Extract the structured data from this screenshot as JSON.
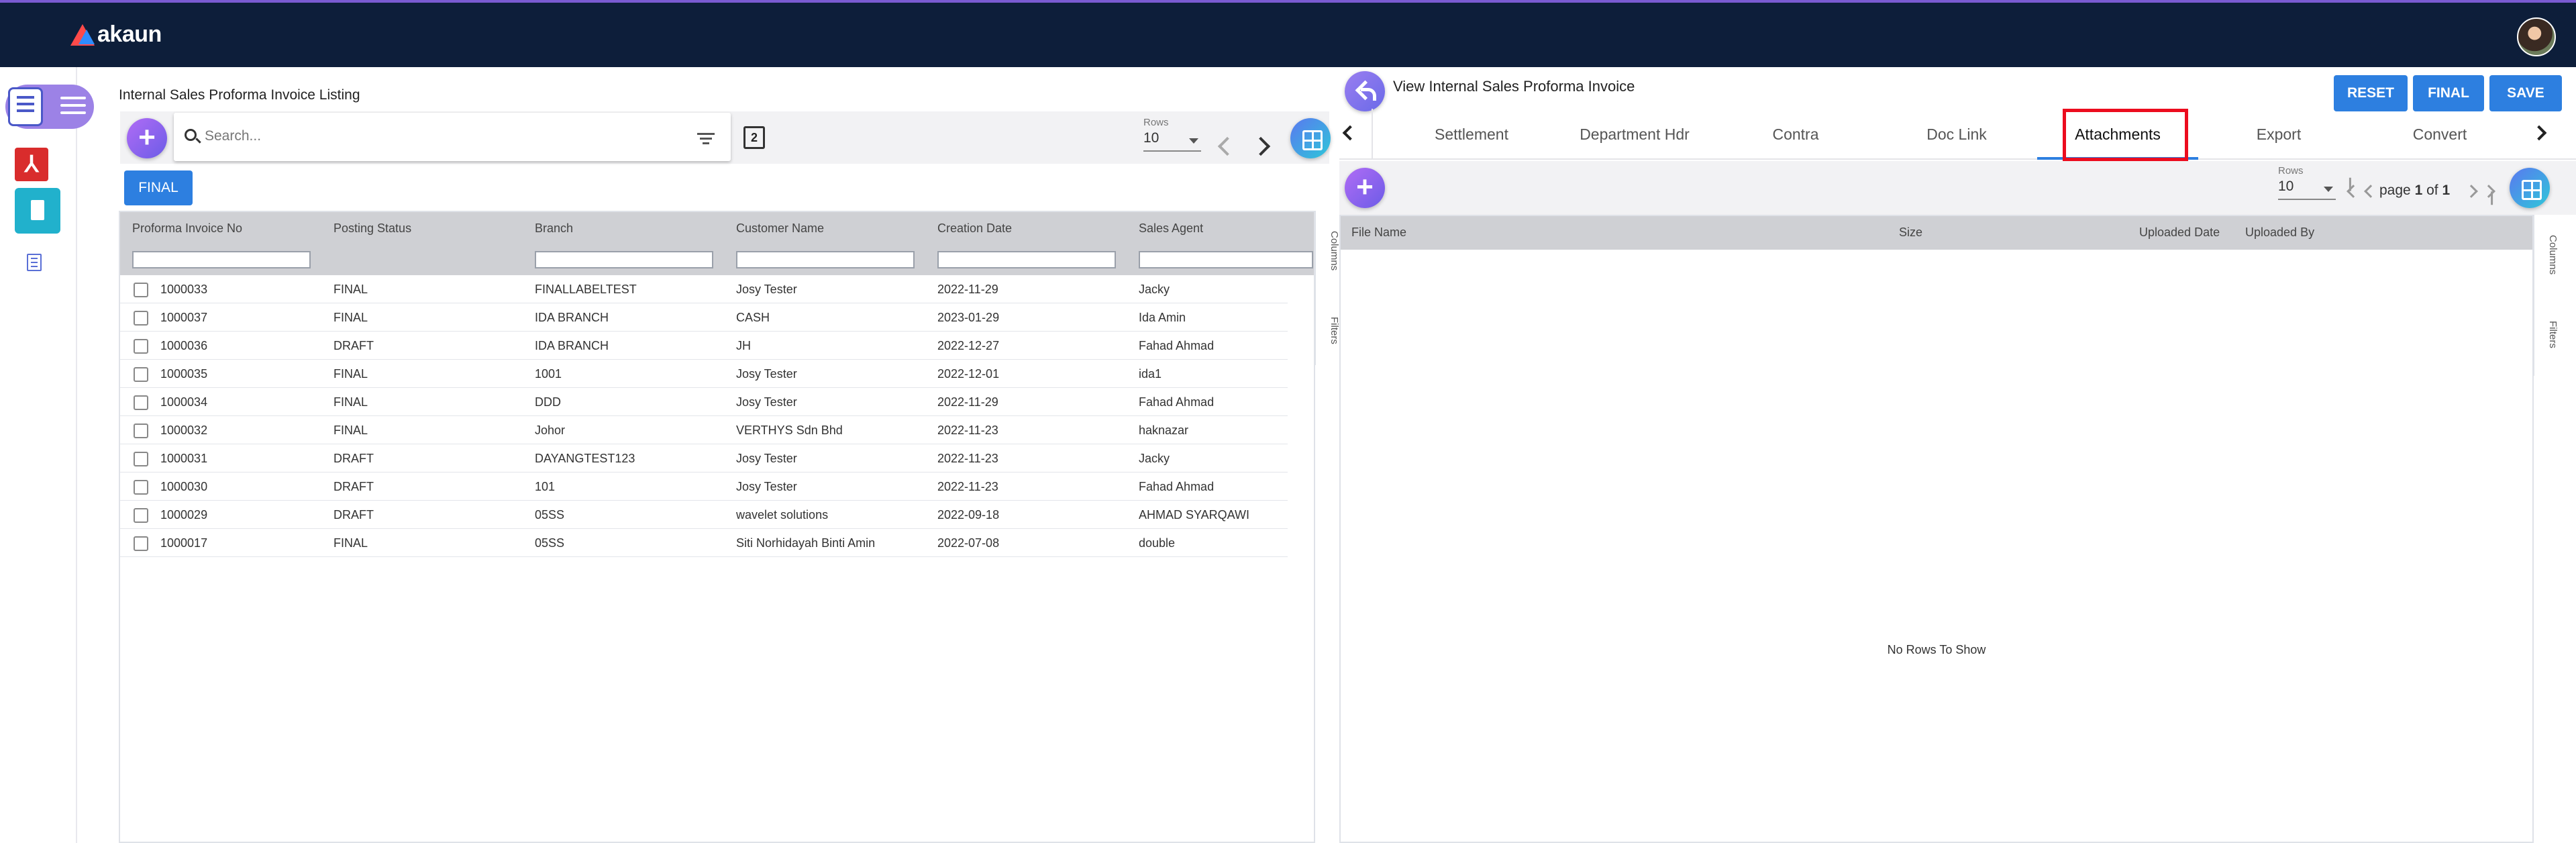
{
  "app": {
    "brand": "akaun"
  },
  "listing": {
    "title": "Internal Sales Proforma Invoice Listing",
    "search_placeholder": "Search...",
    "rows_label": "Rows",
    "rows_value": "10",
    "final_button": "FINAL",
    "columns": [
      "Proforma Invoice No",
      "Posting Status",
      "Branch",
      "Customer Name",
      "Creation Date",
      "Sales Agent"
    ],
    "rows": [
      [
        "1000033",
        "FINAL",
        "FINALLABELTEST",
        "Josy Tester",
        "2022-11-29",
        "Jacky"
      ],
      [
        "1000037",
        "FINAL",
        "IDA BRANCH",
        "CASH",
        "2023-01-29",
        "Ida Amin"
      ],
      [
        "1000036",
        "DRAFT",
        "IDA BRANCH",
        "JH",
        "2022-12-27",
        "Fahad Ahmad"
      ],
      [
        "1000035",
        "FINAL",
        "1001",
        "Josy Tester",
        "2022-12-01",
        "ida1"
      ],
      [
        "1000034",
        "FINAL",
        "DDD",
        "Josy Tester",
        "2022-11-29",
        "Fahad Ahmad"
      ],
      [
        "1000032",
        "FINAL",
        "Johor",
        "VERTHYS Sdn Bhd",
        "2022-11-23",
        "haknazar"
      ],
      [
        "1000031",
        "DRAFT",
        "DAYANGTEST123",
        "Josy Tester",
        "2022-11-23",
        "Jacky"
      ],
      [
        "1000030",
        "DRAFT",
        "101",
        "Josy Tester",
        "2022-11-23",
        "Fahad Ahmad"
      ],
      [
        "1000029",
        "DRAFT",
        "05SS",
        "wavelet solutions",
        "2022-09-18",
        "AHMAD SYARQAWI"
      ],
      [
        "1000017",
        "FINAL",
        "05SS",
        "Siti Norhidayah Binti Amin",
        "2022-07-08",
        "double"
      ]
    ],
    "side_tabs": [
      "Columns",
      "Filters"
    ]
  },
  "detail": {
    "title": "View Internal Sales Proforma Invoice",
    "reset_button": "RESET",
    "final_button": "FINAL",
    "save_button": "SAVE",
    "tabs": [
      "Settlement",
      "Department Hdr",
      "Contra",
      "Doc Link",
      "Attachments",
      "Export",
      "Convert"
    ],
    "active_tab": "Attachments",
    "rows_label": "Rows",
    "rows_value": "10",
    "pager": {
      "prefix": "page",
      "current": "1",
      "of": "of",
      "total": "1"
    },
    "columns": [
      "File Name",
      "Size",
      "Uploaded Date",
      "Uploaded By"
    ],
    "empty_message": "No Rows To Show",
    "side_tabs": [
      "Columns",
      "Filters"
    ]
  },
  "colors": {
    "topbar": "#0d1e3a",
    "accent": "#2d7fe0",
    "highlight": "#ec0c1e",
    "rail_active": "#9c82e6"
  }
}
